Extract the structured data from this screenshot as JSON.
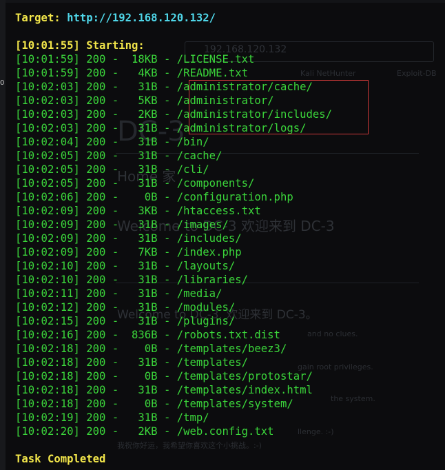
{
  "header": {
    "target_label": "Target:",
    "target_url": "http://192.168.120.132/",
    "start_line": "[10:01:55] Starting:"
  },
  "results": [
    {
      "time": "[10:01:59]",
      "status": "200",
      "size": "18KB",
      "path": "/LICENSE.txt"
    },
    {
      "time": "[10:01:59]",
      "status": "200",
      "size": "4KB",
      "path": "/README.txt"
    },
    {
      "time": "[10:02:03]",
      "status": "200",
      "size": "31B",
      "path": "/administrator/cache/"
    },
    {
      "time": "[10:02:03]",
      "status": "200",
      "size": "5KB",
      "path": "/administrator/"
    },
    {
      "time": "[10:02:03]",
      "status": "200",
      "size": "2KB",
      "path": "/administrator/includes/"
    },
    {
      "time": "[10:02:03]",
      "status": "200",
      "size": "31B",
      "path": "/administrator/logs/"
    },
    {
      "time": "[10:02:04]",
      "status": "200",
      "size": "31B",
      "path": "/bin/"
    },
    {
      "time": "[10:02:05]",
      "status": "200",
      "size": "31B",
      "path": "/cache/"
    },
    {
      "time": "[10:02:05]",
      "status": "200",
      "size": "31B",
      "path": "/cli/"
    },
    {
      "time": "[10:02:05]",
      "status": "200",
      "size": "31B",
      "path": "/components/"
    },
    {
      "time": "[10:02:06]",
      "status": "200",
      "size": "0B",
      "path": "/configuration.php"
    },
    {
      "time": "[10:02:09]",
      "status": "200",
      "size": "3KB",
      "path": "/htaccess.txt"
    },
    {
      "time": "[10:02:09]",
      "status": "200",
      "size": "31B",
      "path": "/images/"
    },
    {
      "time": "[10:02:09]",
      "status": "200",
      "size": "31B",
      "path": "/includes/"
    },
    {
      "time": "[10:02:09]",
      "status": "200",
      "size": "7KB",
      "path": "/index.php"
    },
    {
      "time": "[10:02:10]",
      "status": "200",
      "size": "31B",
      "path": "/layouts/"
    },
    {
      "time": "[10:02:10]",
      "status": "200",
      "size": "31B",
      "path": "/libraries/"
    },
    {
      "time": "[10:02:11]",
      "status": "200",
      "size": "31B",
      "path": "/media/"
    },
    {
      "time": "[10:02:12]",
      "status": "200",
      "size": "31B",
      "path": "/modules/"
    },
    {
      "time": "[10:02:15]",
      "status": "200",
      "size": "31B",
      "path": "/plugins/"
    },
    {
      "time": "[10:02:16]",
      "status": "200",
      "size": "836B",
      "path": "/robots.txt.dist"
    },
    {
      "time": "[10:02:18]",
      "status": "200",
      "size": "0B",
      "path": "/templates/beez3/"
    },
    {
      "time": "[10:02:18]",
      "status": "200",
      "size": "31B",
      "path": "/templates/"
    },
    {
      "time": "[10:02:18]",
      "status": "200",
      "size": "0B",
      "path": "/templates/protostar/"
    },
    {
      "time": "[10:02:18]",
      "status": "200",
      "size": "31B",
      "path": "/templates/index.html"
    },
    {
      "time": "[10:02:18]",
      "status": "200",
      "size": "0B",
      "path": "/templates/system/"
    },
    {
      "time": "[10:02:19]",
      "status": "200",
      "size": "31B",
      "path": "/tmp/"
    },
    {
      "time": "[10:02:20]",
      "status": "200",
      "size": "2KB",
      "path": "/web.config.txt"
    }
  ],
  "footer": {
    "done": "Task Completed"
  },
  "colors": {
    "yellow": "#f2e64a",
    "cyan": "#4fd6e8",
    "green": "#3bd63b",
    "box": "#d13a3a"
  },
  "ghost_page": {
    "address": "192.168.120.132",
    "bookmark_1": "Kali NetHunter",
    "bookmark_2": "Exploit-DB",
    "heading": "DC-3",
    "home": "Home 家",
    "welcome_1": "Welcome to DC-3 欢迎来到 DC-3",
    "welcome_2": "Welcome to DC-3. 欢迎来到 DC-3。",
    "p1": "and no clues.",
    "p2": "gain root privileges.",
    "p3": "the system.",
    "p4": "llenge. :-)",
    "p5": "我祝你好运，我希望你喜欢这个小挑战。:-)"
  }
}
